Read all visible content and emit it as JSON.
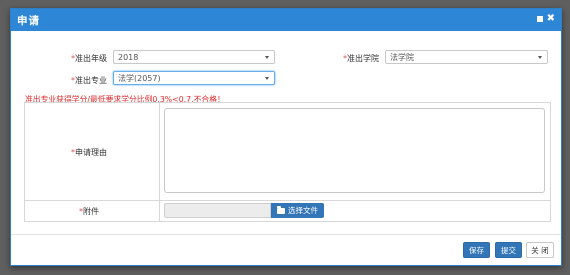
{
  "modal": {
    "title": "申请"
  },
  "form": {
    "year": {
      "label": "准出年级",
      "value": "2018"
    },
    "college": {
      "label": "准出学院",
      "value": "法学院"
    },
    "major": {
      "label": "准出专业",
      "value": "法学(2057)"
    },
    "required_mark": "*"
  },
  "warning": "准出专业获得学分/最低要求学分比例0.3%<0.7,不合格！",
  "table": {
    "reason_label": "申请理由",
    "attachment_label": "附件",
    "reason_value": "",
    "file_value": "",
    "choose_file": "选择文件"
  },
  "footer": {
    "save": "保存",
    "submit": "提交",
    "close": "关 闭"
  },
  "colors": {
    "header": "#2e86d6",
    "primary_button": "#3376b8",
    "warning_text": "#e0282a",
    "required": "#d9534f"
  }
}
